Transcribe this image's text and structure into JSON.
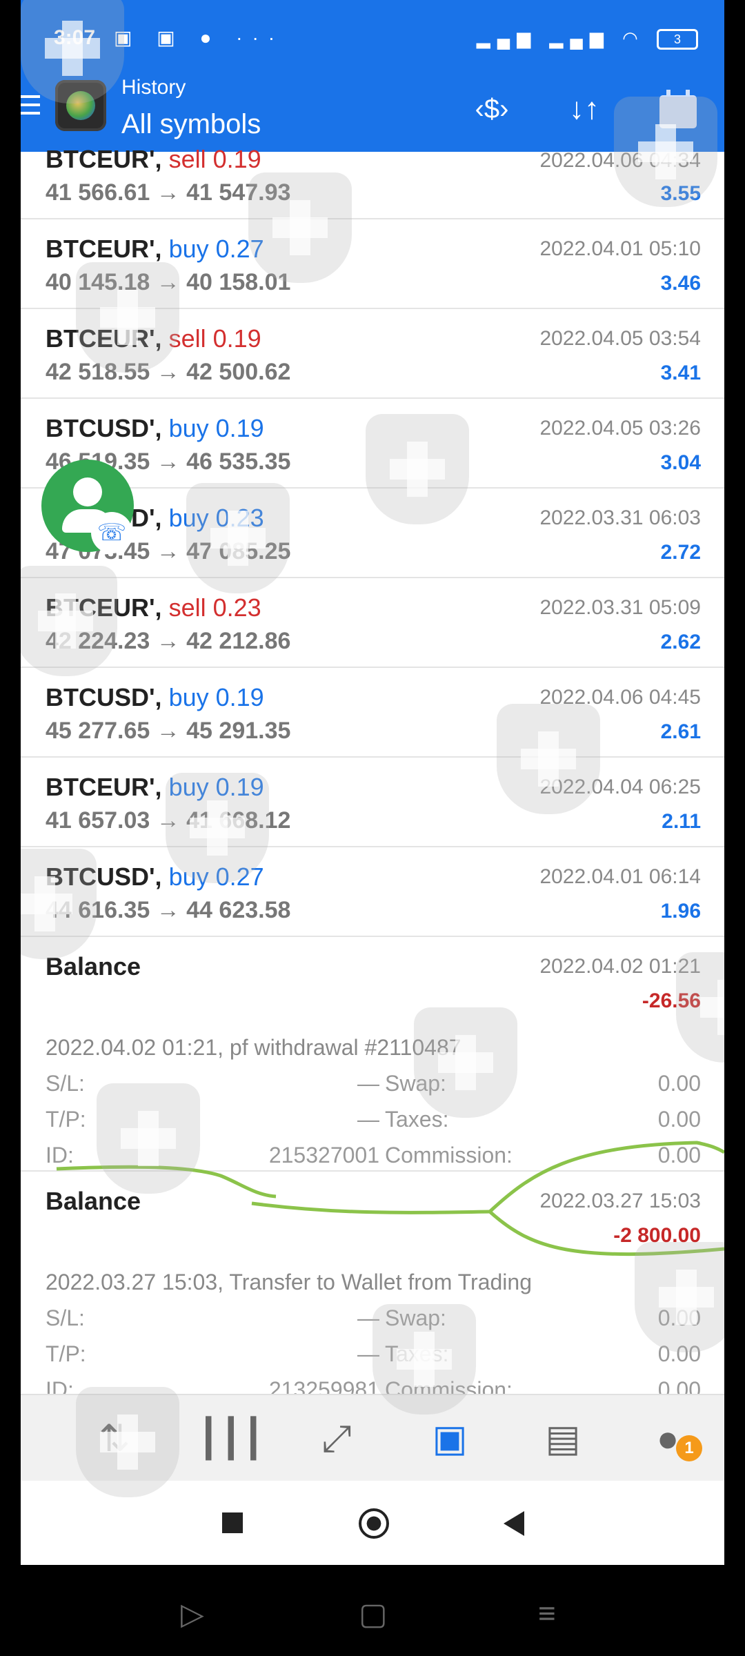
{
  "status_bar": {
    "time": "3:07",
    "left_icons": "▣ ▣ ● ···",
    "right_icons": "▂▄▆ ▂▄▆ ◠",
    "battery": "3"
  },
  "header": {
    "subtitle": "History",
    "title": "All symbols",
    "icons": [
      "menu-icon",
      "app-logo",
      "currency-exchange-icon",
      "sort-icon",
      "calendar-icon"
    ]
  },
  "deals": [
    {
      "symbol": "BTCEUR',",
      "side": "sell",
      "volume": "sell 0.19",
      "prices": "41 566.61 → 41 547.93",
      "time": "2022.04.06 04:34",
      "profit": "3.55"
    },
    {
      "symbol": "BTCEUR',",
      "side": "buy",
      "volume": "buy 0.27",
      "prices": "40 145.18 → 40 158.01",
      "time": "2022.04.01 05:10",
      "profit": "3.46"
    },
    {
      "symbol": "BTCEUR',",
      "side": "sell",
      "volume": "sell 0.19",
      "prices": "42 518.55 → 42 500.62",
      "time": "2022.04.05 03:54",
      "profit": "3.41"
    },
    {
      "symbol": "BTCUSD',",
      "side": "buy",
      "volume": "buy 0.19",
      "prices": "46 519.35 → 46 535.35",
      "time": "2022.04.05 03:26",
      "profit": "3.04"
    },
    {
      "symbol": "BTCUSD',",
      "side": "buy",
      "volume": "buy 0.23",
      "prices": "47 073.45 → 47 085.25",
      "time": "2022.03.31 06:03",
      "profit": "2.72"
    },
    {
      "symbol": "BTCEUR',",
      "side": "sell",
      "volume": "sell 0.23",
      "prices": "42 224.23 → 42 212.86",
      "time": "2022.03.31 05:09",
      "profit": "2.62"
    },
    {
      "symbol": "BTCUSD',",
      "side": "buy",
      "volume": "buy 0.19",
      "prices": "45 277.65 → 45 291.35",
      "time": "2022.04.06 04:45",
      "profit": "2.61"
    },
    {
      "symbol": "BTCEUR',",
      "side": "buy",
      "volume": "buy 0.19",
      "prices": "41 657.03 → 41 668.12",
      "time": "2022.04.04 06:25",
      "profit": "2.11"
    },
    {
      "symbol": "BTCUSD',",
      "side": "buy",
      "volume": "buy 0.27",
      "prices": "44 616.35 → 44 623.58",
      "time": "2022.04.01 06:14",
      "profit": "1.96"
    }
  ],
  "balances": [
    {
      "title": "Balance",
      "time": "2022.04.02 01:21",
      "amount": "-26.56",
      "comment": "2022.04.02 01:21, pf withdrawal #2110487",
      "sl_label": "S/L:",
      "sl_value": "—",
      "tp_label": "T/P:",
      "tp_value": "—",
      "id_label": "ID:",
      "id_value": "215327001",
      "swap_label": "Swap:",
      "swap_value": "0.00",
      "taxes_label": "Taxes:",
      "taxes_value": "0.00",
      "commission_label": "Commission:",
      "commission_value": "0.00"
    },
    {
      "title": "Balance",
      "time": "2022.03.27 15:03",
      "amount": "-2 800.00",
      "comment": "2022.03.27 15:03, Transfer to Wallet from Trading",
      "sl_label": "S/L:",
      "sl_value": "—",
      "tp_label": "T/P:",
      "tp_value": "—",
      "id_label": "ID:",
      "id_value": "213259981",
      "swap_label": "Swap:",
      "swap_value": "0.00",
      "taxes_label": "Taxes:",
      "taxes_value": "0.00",
      "commission_label": "Commission:",
      "commission_value": "0.00"
    }
  ],
  "bottom_nav": {
    "items": [
      "quotes-icon",
      "chart-icon",
      "trade-icon",
      "history-icon",
      "news-icon",
      "messages-icon"
    ],
    "active": "history-icon",
    "message_badge": "1"
  },
  "colors": {
    "header_blue": "#1a73e8",
    "buy_blue": "#1a73e8",
    "sell_red": "#d32f2f",
    "loss_red": "#c62828",
    "badge_orange": "#f59a1a",
    "highlight_green": "#8bc34a"
  }
}
